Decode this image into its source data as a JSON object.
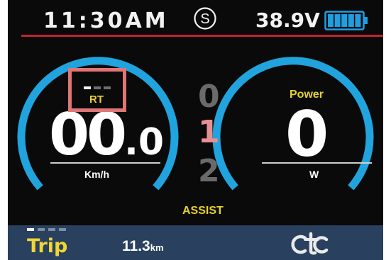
{
  "status": {
    "time": "11:30AM",
    "mode_symbol": "S",
    "voltage": "38.9V",
    "battery_level": 1.0,
    "battery_segments": 5,
    "mode_icon": "s-circle-icon",
    "battery_icon": "battery-icon"
  },
  "speed": {
    "main": "00",
    "decimal": ".0",
    "unit": "Km/h"
  },
  "riding_mode": {
    "label": "RT",
    "active_dot_index": 0,
    "dot_count": 3
  },
  "assist": {
    "levels": [
      "0",
      "1",
      "2"
    ],
    "active_level": "1",
    "label": "ASSIST"
  },
  "power": {
    "label": "Power",
    "value": "0",
    "unit": "W"
  },
  "trip": {
    "label": "Trip",
    "value": "11.3",
    "unit": "km",
    "active_dot_index": 0,
    "dot_count": 4
  },
  "logo_icon": "brand-logo-icon",
  "colors": {
    "arc": "#21a3dd",
    "highlight": "#e07575",
    "label_yellow": "#e8d22a",
    "status_red": "#c0242b",
    "bottom_bar": "#29405e",
    "battery": "#1f9ee0"
  }
}
